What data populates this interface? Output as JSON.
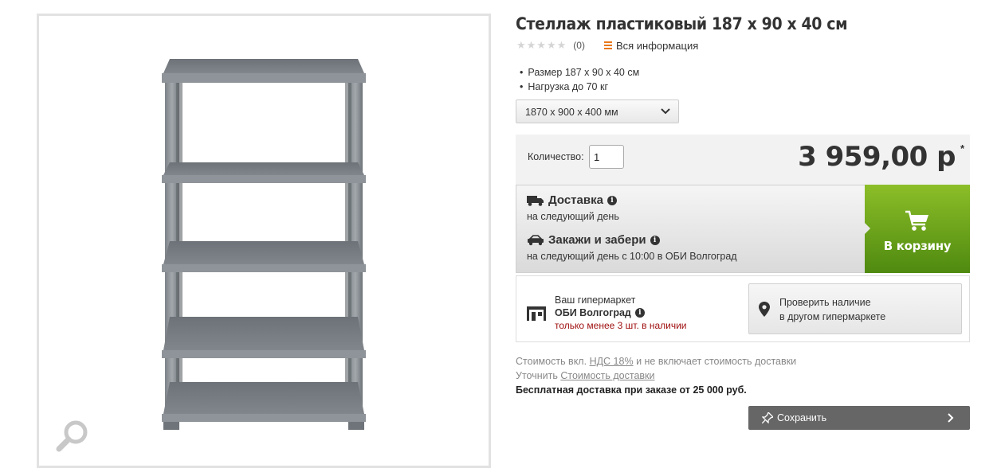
{
  "product": {
    "title": "Стеллаж пластиковый 187 x 90 x 40 см",
    "stars": "★★★★★",
    "review_count": "(0)",
    "all_info_label": "Вся информация",
    "bullets": [
      "Размер 187 x 90 x 40 см",
      "Нагрузка до 70 кг"
    ],
    "size_option": "1870 x 900 x 400 мм"
  },
  "purchase": {
    "qty_label": "Количество:",
    "qty_value": "1",
    "price": "3 959,00 р",
    "price_mark": "*"
  },
  "delivery": {
    "title": "Доставка",
    "subtitle": "на следующий день",
    "pickup_title": "Закажи и забери",
    "pickup_subtitle": "на следующий день с 10:00 в ОБИ Волгоград"
  },
  "cart": {
    "label": "В корзину"
  },
  "store": {
    "label": "Ваш гипермаркет",
    "name": "ОБИ Волгоград",
    "availability": "только менее 3 шт. в наличии",
    "check_line1": "Проверить наличие",
    "check_line2": "в другом гипермаркете"
  },
  "notes": {
    "vat_prefix": "Стоимость вкл.",
    "vat_link": "НДС 18%",
    "vat_suffix": "и не включает стоимость доставки",
    "clarify_prefix": "Уточнить",
    "clarify_link": "Стоимость доставки",
    "free_delivery": "Бесплатная доставка при заказе от 25 000 руб."
  },
  "save": {
    "label": "Сохранить"
  },
  "colors": {
    "cart_green": "#6aa31c",
    "availability_red": "#a01010",
    "accent_orange": "#e8781a"
  },
  "icons": [
    "zoom-icon",
    "list-icon",
    "chevron-down-icon",
    "truck-icon",
    "car-icon",
    "info-icon",
    "cart-icon",
    "store-icon",
    "map-pin-icon",
    "pin-icon",
    "chevron-right-icon"
  ]
}
